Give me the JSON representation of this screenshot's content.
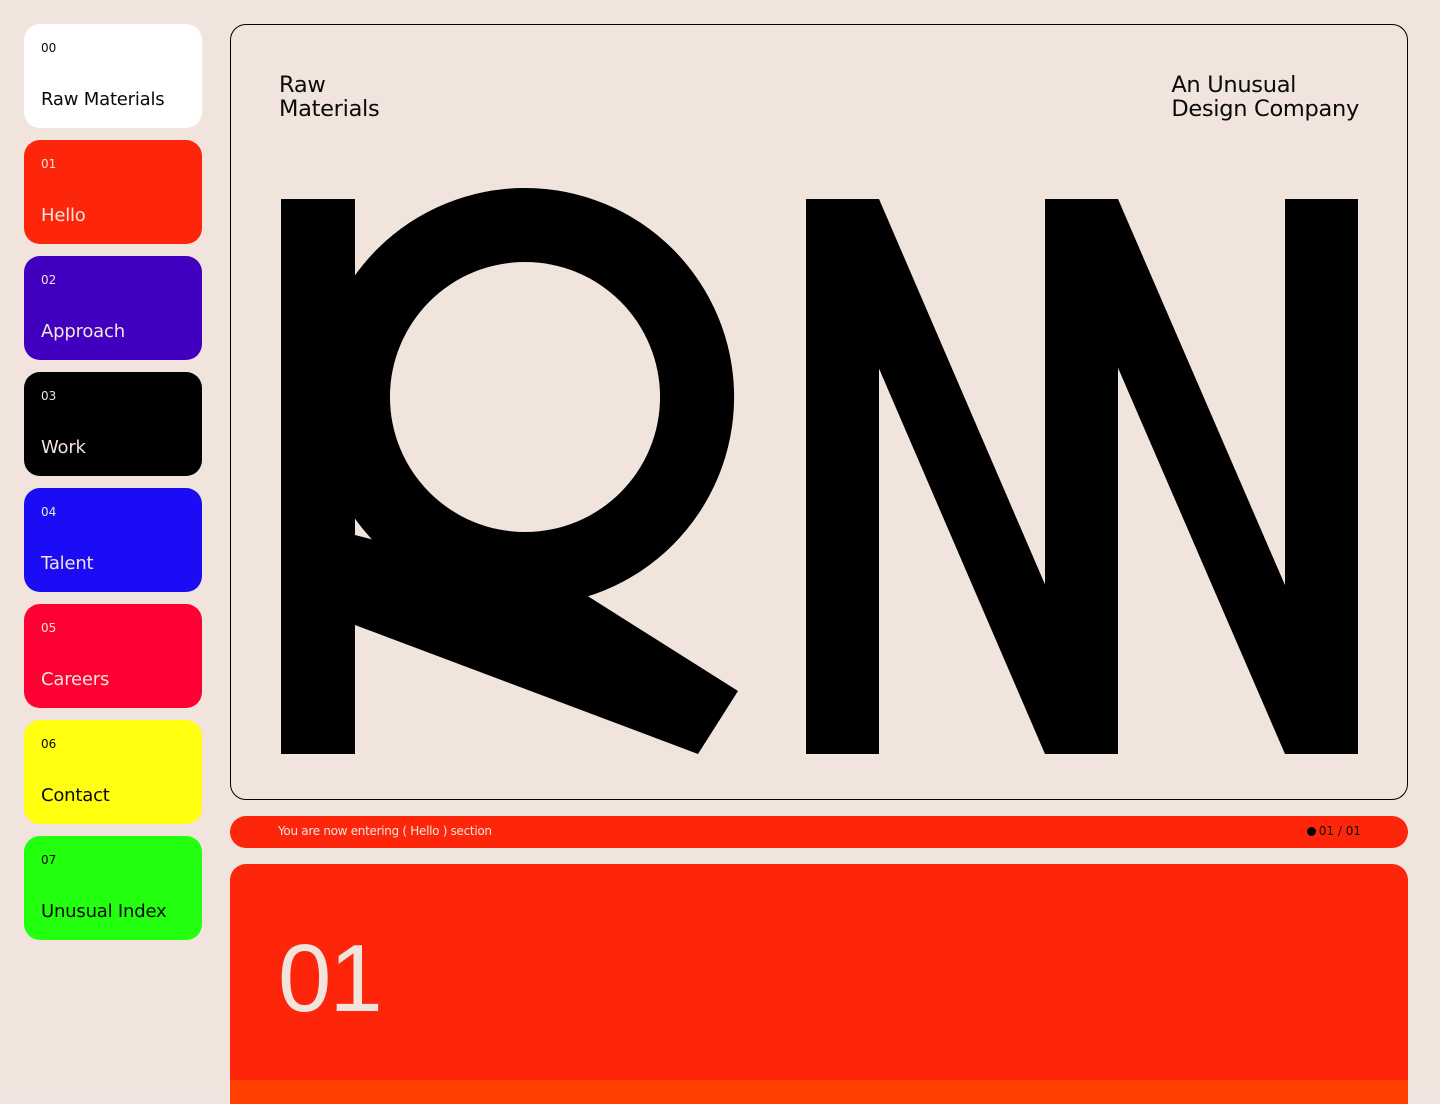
{
  "sidebar": {
    "items": [
      {
        "num": "00",
        "label": "Raw Materials",
        "bg": "#ffffff",
        "fg": "#0a0a0a"
      },
      {
        "num": "01",
        "label": "Hello",
        "bg": "#fd260b",
        "fg": "#f0e4dc"
      },
      {
        "num": "02",
        "label": "Approach",
        "bg": "#4100bf",
        "fg": "#f0e4dc"
      },
      {
        "num": "03",
        "label": "Work",
        "bg": "#000000",
        "fg": "#f0e4dc"
      },
      {
        "num": "04",
        "label": "Talent",
        "bg": "#1c0cf5",
        "fg": "#f0e4dc"
      },
      {
        "num": "05",
        "label": "Careers",
        "bg": "#ff0033",
        "fg": "#f0e4dc"
      },
      {
        "num": "06",
        "label": "Contact",
        "bg": "#ffff0f",
        "fg": "#0a0a0a"
      },
      {
        "num": "07",
        "label": "Unusual Index",
        "bg": "#22ff0f",
        "fg": "#0a0a0a"
      }
    ]
  },
  "hero": {
    "left_line1": "Raw",
    "left_line2": "Materials",
    "right_line1": "An Unusual",
    "right_line2": "Design Company",
    "logo_icon": "rm-monogram-logo"
  },
  "status": {
    "text": "You are now entering ( Hello ) section",
    "counter": "01 / 01"
  },
  "section": {
    "number": "01"
  },
  "colors": {
    "background": "#f0e4dc",
    "accent": "#fd260b",
    "ink": "#000000"
  }
}
